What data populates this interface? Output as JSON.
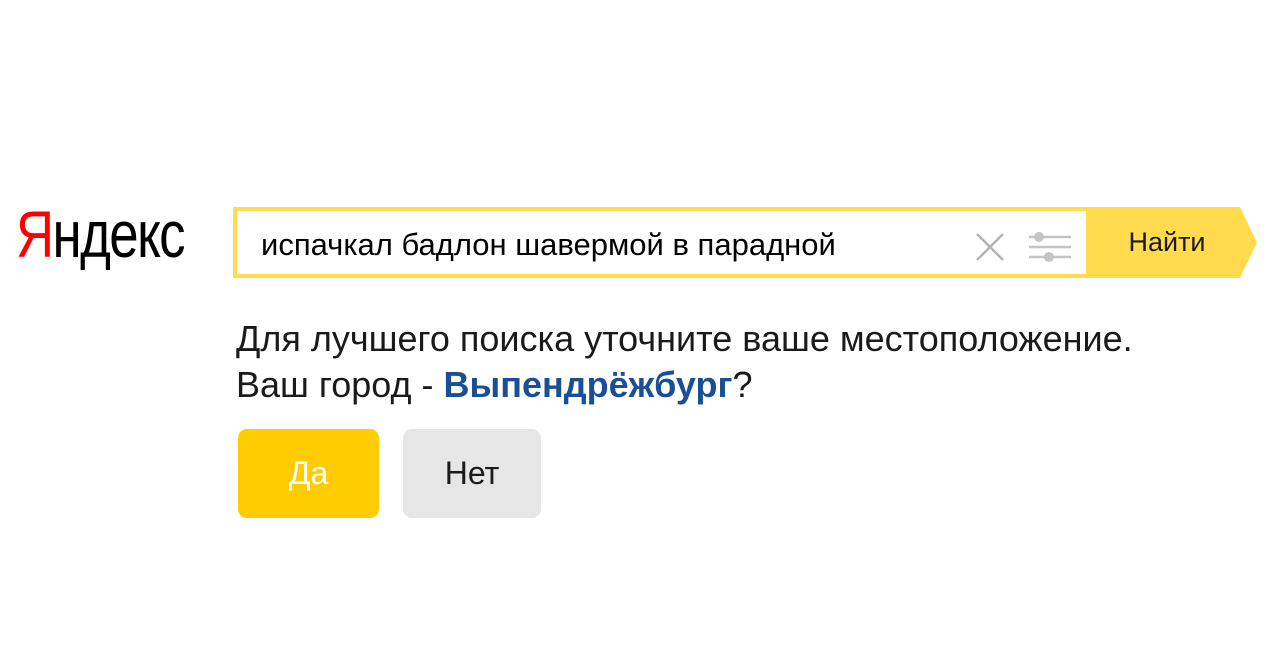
{
  "logo": {
    "first_letter": "Я",
    "rest": "ндекс"
  },
  "search": {
    "query": "испачкал бадлон шавермой в парадной",
    "find_label": "Найти"
  },
  "location_prompt": {
    "line1": "Для лучшего поиска уточните ваше местоположение.",
    "line2_prefix": "Ваш город - ",
    "city": "Выпендрёжбург",
    "line2_suffix": "?"
  },
  "buttons": {
    "yes": "Да",
    "no": "Нет"
  },
  "colors": {
    "brand_red": "#ff0000",
    "search_border": "#ffdb4d",
    "find_button": "#ffdb4d",
    "yes_button": "#ffcc00",
    "no_button": "#e6e6e6",
    "city_link": "#1a4f96"
  },
  "icons": {
    "clear": "close-icon",
    "settings": "sliders-icon"
  }
}
